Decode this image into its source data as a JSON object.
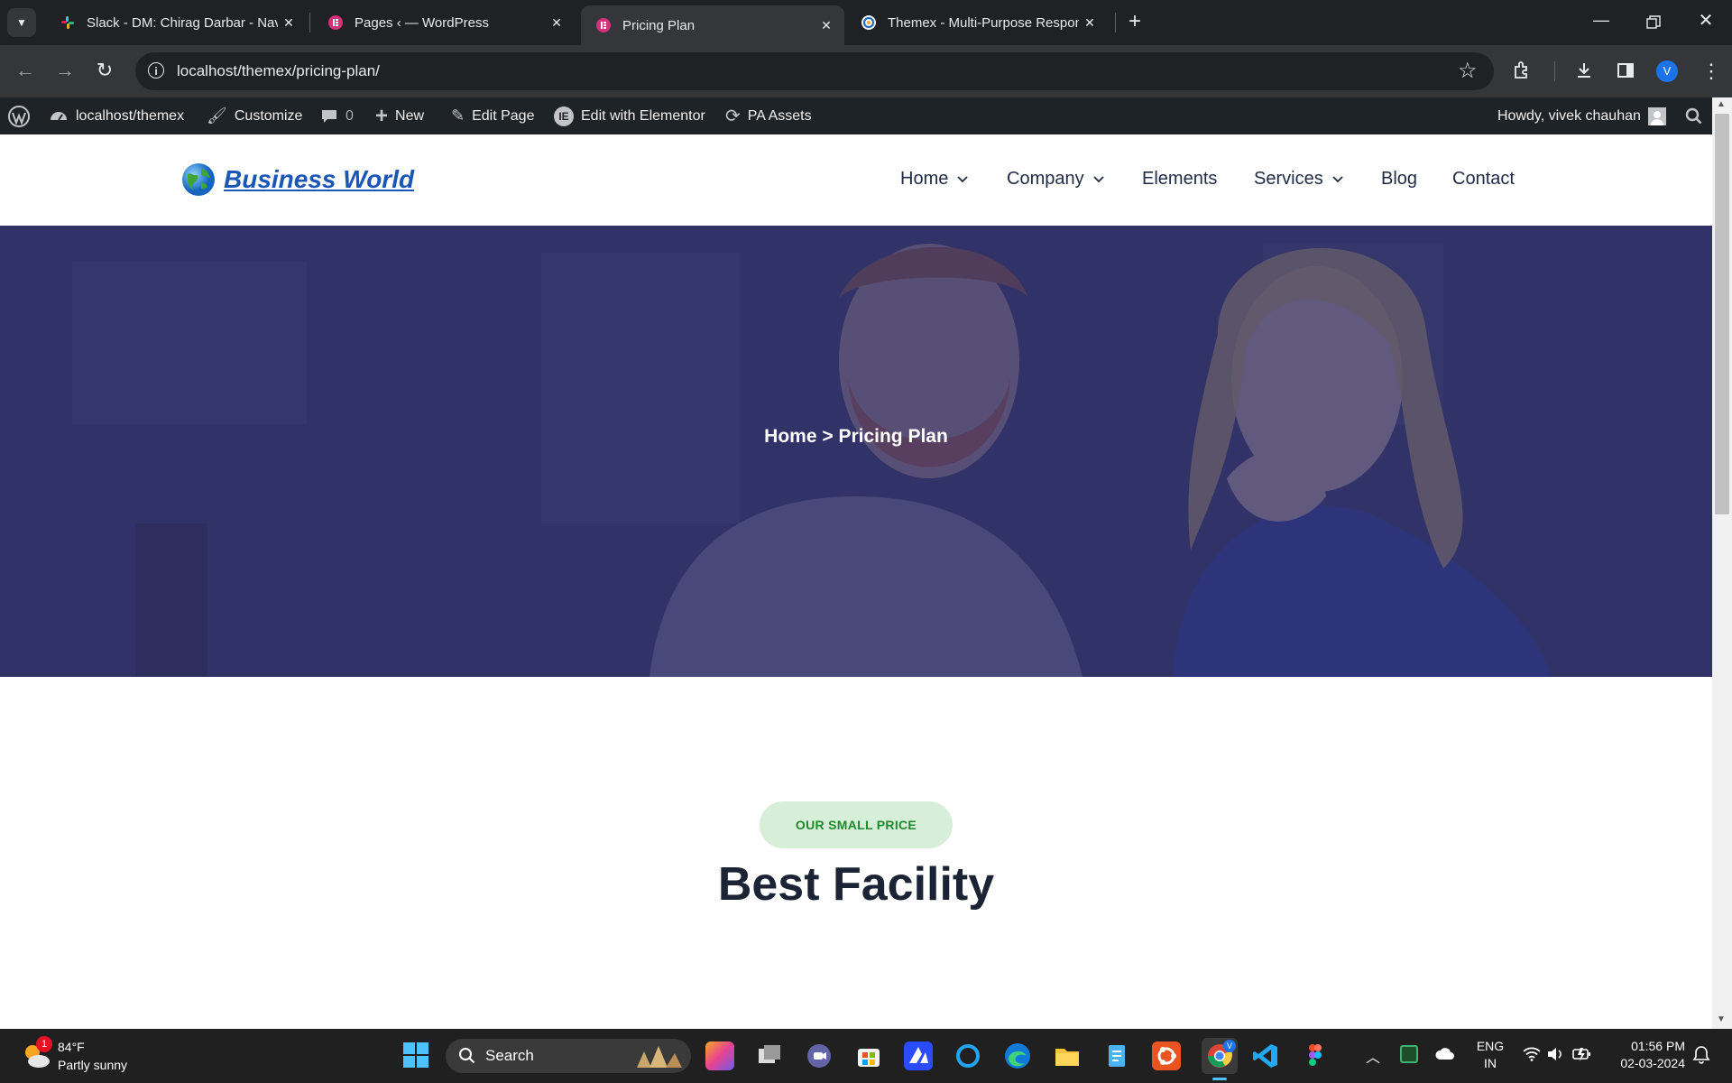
{
  "browser": {
    "tabs": [
      {
        "title": "Slack - DM: Chirag Darbar - Nav",
        "active": false
      },
      {
        "title": "Pages ‹ — WordPress",
        "active": false
      },
      {
        "title": "Pricing Plan",
        "active": true
      },
      {
        "title": "Themex - Multi-Purpose Respon",
        "active": false
      }
    ],
    "url": "localhost/themex/pricing-plan/",
    "profile_initial": "V"
  },
  "admin_bar": {
    "site": "localhost/themex",
    "customize": "Customize",
    "comments": "0",
    "new": "New",
    "edit_page": "Edit Page",
    "edit_elementor": "Edit with Elementor",
    "pa_assets": "PA Assets",
    "howdy": "Howdy, vivek chauhan"
  },
  "site": {
    "logo_text": "Business World",
    "nav": [
      {
        "label": "Home",
        "dropdown": true
      },
      {
        "label": "Company",
        "dropdown": true
      },
      {
        "label": "Elements",
        "dropdown": false
      },
      {
        "label": "Services",
        "dropdown": true
      },
      {
        "label": "Blog",
        "dropdown": false
      },
      {
        "label": "Contact",
        "dropdown": false
      }
    ],
    "breadcrumb": "Home > Pricing Plan",
    "badge": "OUR SMALL PRICE",
    "heading": "Best Facility"
  },
  "taskbar": {
    "weather_temp": "84°F",
    "weather_desc": "Partly sunny",
    "weather_badge": "1",
    "search_placeholder": "Search",
    "lang_1": "ENG",
    "lang_2": "IN",
    "time": "01:56 PM",
    "date": "02-03-2024"
  },
  "colors": {
    "nav_text": "#1f2a44",
    "badge_bg": "#d7efd9",
    "badge_text": "#1e8a2e",
    "heading": "#1b2435",
    "hero_overlay": "#2e2f63"
  }
}
